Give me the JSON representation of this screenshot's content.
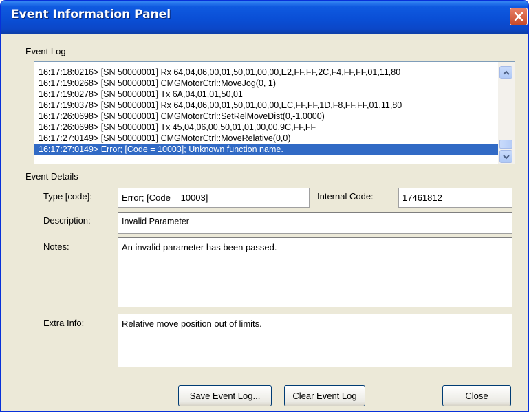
{
  "window": {
    "title": "Event Information Panel"
  },
  "event_log": {
    "group_label": "Event Log",
    "lines": [
      "16:17:18:0216> [SN 50000001] Rx 64,04,06,00,01,50,01,00,00,E2,FF,FF,2C,F4,FF,FF,01,11,80",
      "16:17:19:0268> [SN 50000001] CMGMotorCtrl::MoveJog(0, 1)",
      "16:17:19:0278> [SN 50000001] Tx 6A,04,01,01,50,01",
      "16:17:19:0378> [SN 50000001] Rx 64,04,06,00,01,50,01,00,00,EC,FF,FF,1D,F8,FF,FF,01,11,80",
      "16:17:26:0698> [SN 50000001] CMGMotorCtrl::SetRelMoveDist(0,-1.0000)",
      "16:17:26:0698> [SN 50000001] Tx 45,04,06,00,50,01,01,00,00,9C,FF,FF",
      "16:17:27:0149> [SN 50000001] CMGMotorCtrl::MoveRelative(0,0)",
      "16:17:27:0149> Error; [Code = 10003]; Unknown function name."
    ],
    "selected_index": 7
  },
  "event_details": {
    "group_label": "Event Details",
    "type_label": "Type [code]:",
    "type_value": "Error; [Code = 10003]",
    "internal_code_label": "Internal Code:",
    "internal_code_value": "17461812",
    "description_label": "Description:",
    "description_value": "Invalid Parameter",
    "notes_label": "Notes:",
    "notes_value": "An invalid parameter has been passed.",
    "extra_info_label": "Extra Info:",
    "extra_info_value": "Relative move position out of limits."
  },
  "buttons": {
    "save_event_log": "Save Event Log...",
    "clear_event_log": "Clear Event Log",
    "close": "Close"
  },
  "icons": {
    "close": "close-icon",
    "scroll_up": "chevron-up-icon",
    "scroll_down": "chevron-down-icon"
  }
}
